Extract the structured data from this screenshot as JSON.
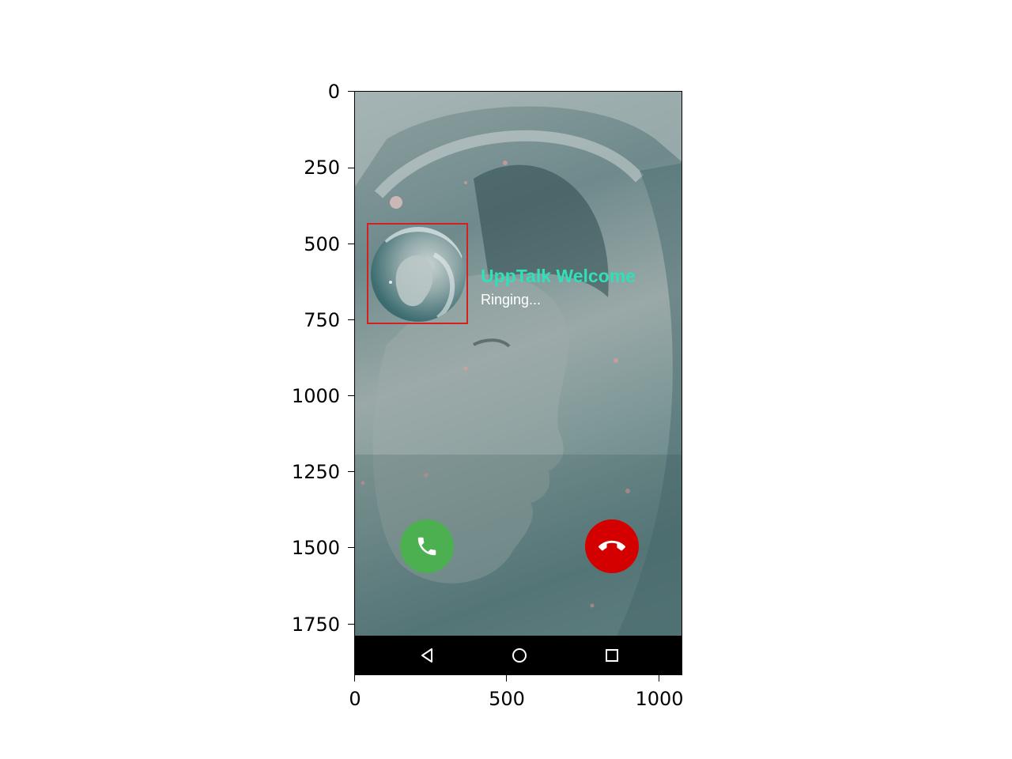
{
  "axes": {
    "y_ticks": [
      "0",
      "250",
      "500",
      "750",
      "1000",
      "1250",
      "1500",
      "1750"
    ],
    "x_ticks": [
      "0",
      "500",
      "1000"
    ]
  },
  "call": {
    "caller_name": "UppTalk Welcome",
    "status": "Ringing..."
  },
  "buttons": {
    "accept_icon": "phone-icon",
    "decline_icon": "hang-up-icon",
    "accept_color": "#4caf50",
    "decline_color": "#d40000"
  },
  "nav": {
    "back_icon": "back-triangle-icon",
    "home_icon": "home-circle-icon",
    "recents_icon": "recents-square-icon"
  },
  "colors": {
    "caller_name": "#2fe0b8",
    "highlight_box": "#d42020"
  }
}
